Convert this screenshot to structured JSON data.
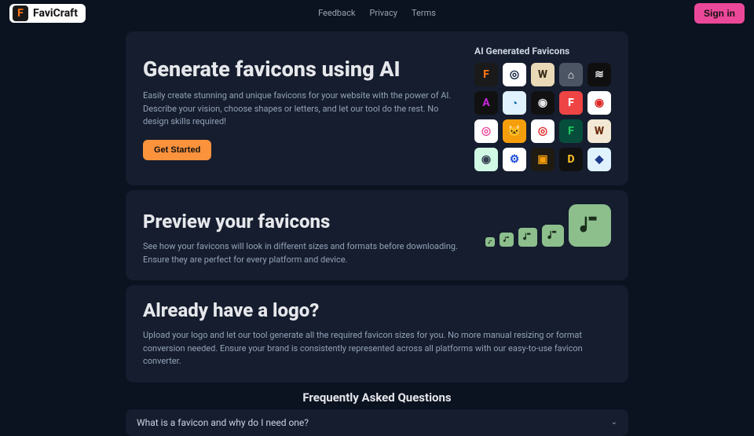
{
  "brand": "FaviCraft",
  "nav": {
    "feedback": "Feedback",
    "privacy": "Privacy",
    "terms": "Terms"
  },
  "signin": "Sign in",
  "hero": {
    "title": "Generate favicons using AI",
    "body": "Easily create stunning and unique favicons for your website with the power of AI. Describe your vision, choose shapes or letters, and let our tool do the rest. No design skills required!",
    "cta": "Get Started",
    "grid_label": "AI Generated Favicons"
  },
  "favicons": [
    {
      "bg": "#1a1a1a",
      "fg": "#f97316",
      "t": "F"
    },
    {
      "bg": "#ffffff",
      "fg": "#0b1d3a",
      "t": "◎"
    },
    {
      "bg": "#ead9b6",
      "fg": "#3a2f1a",
      "t": "W"
    },
    {
      "bg": "#4b5563",
      "fg": "#ffffff",
      "t": "⌂"
    },
    {
      "bg": "#0f0f0f",
      "fg": "#e5e7eb",
      "t": "≋"
    },
    {
      "bg": "#111111",
      "fg": "#c026d3",
      "t": "A"
    },
    {
      "bg": "#e0f2fe",
      "fg": "#0369a1",
      "t": "◔"
    },
    {
      "bg": "#111111",
      "fg": "#e5e7eb",
      "t": "◉"
    },
    {
      "bg": "#ef4444",
      "fg": "#ffffff",
      "t": "F"
    },
    {
      "bg": "#ffffff",
      "fg": "#dc2626",
      "t": "◉"
    },
    {
      "bg": "#ffffff",
      "fg": "#ec4899",
      "t": "◎"
    },
    {
      "bg": "#f59e0b",
      "fg": "#1f2937",
      "t": "🐱"
    },
    {
      "bg": "#ffffff",
      "fg": "#dc2626",
      "t": "◎"
    },
    {
      "bg": "#064e3b",
      "fg": "#22c55e",
      "t": "F"
    },
    {
      "bg": "#f3e8d3",
      "fg": "#6b2f0f",
      "t": "W"
    },
    {
      "bg": "#d1fae5",
      "fg": "#374151",
      "t": "◉"
    },
    {
      "bg": "#ffffff",
      "fg": "#1d4ed8",
      "t": "⚙"
    },
    {
      "bg": "#1f1a12",
      "fg": "#f59e0b",
      "t": "▣"
    },
    {
      "bg": "#111111",
      "fg": "#fbbf24",
      "t": "D"
    },
    {
      "bg": "#e0f2fe",
      "fg": "#1e3a8a",
      "t": "◆"
    }
  ],
  "preview": {
    "title": "Preview your favicons",
    "body": "See how your favicons will look in different sizes and formats before downloading. Ensure they are perfect for every platform and device.",
    "icon_color": "#8dbf8d"
  },
  "logo_section": {
    "title": "Already have a logo?",
    "body": "Upload your logo and let our tool generate all the required favicon sizes for you. No more manual resizing or format conversion needed. Ensure your brand is consistently represented across all platforms with our easy-to-use favicon converter."
  },
  "faq": {
    "title": "Frequently Asked Questions",
    "q1": "What is a favicon and why do I need one?"
  }
}
